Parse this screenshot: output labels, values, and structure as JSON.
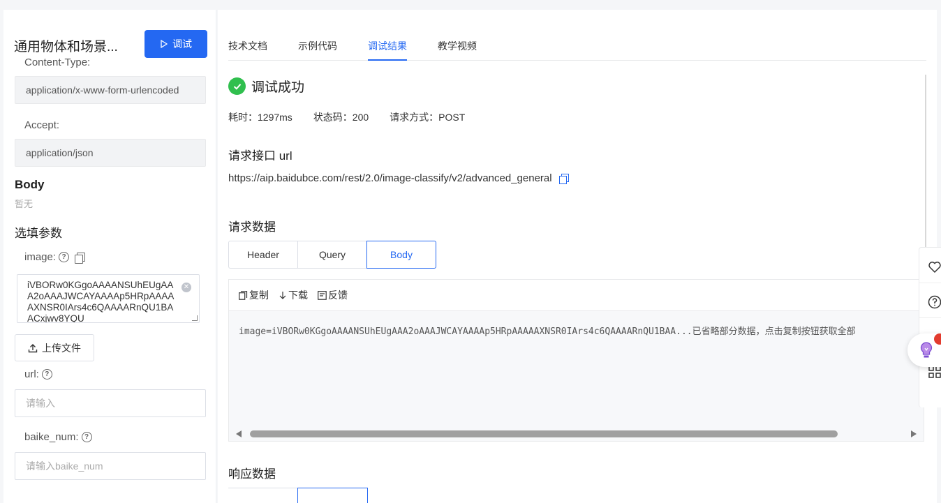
{
  "left": {
    "api_title": "通用物体和场景...",
    "debug_button": "调试",
    "content_type_label": "Content-Type:",
    "content_type_value": "application/x-www-form-urlencoded",
    "accept_label": "Accept:",
    "accept_value": "application/json",
    "body_heading": "Body",
    "body_empty": "暂无",
    "optional_heading": "选填参数",
    "image_label": "image:",
    "image_value": "iVBORw0KGgoAAAANSUhEUgAAA2oAAAJWCAYAAAAp5HRpAAAAAXNSR0IArs4c6QAAAARnQU1BAACxjwv8YQU",
    "upload_button": "上传文件",
    "url_label": "url:",
    "url_placeholder": "请输入",
    "baike_label": "baike_num:",
    "baike_placeholder": "请输入baike_num"
  },
  "tabs": [
    {
      "label": "技术文档"
    },
    {
      "label": "示例代码"
    },
    {
      "label": "调试结果",
      "active": true
    },
    {
      "label": "教学视频"
    }
  ],
  "result": {
    "status": "调试成功",
    "time": "耗时：1297ms",
    "status_code": "状态码：200",
    "method": "请求方式：POST",
    "url_heading": "请求接口 url",
    "url": "https://aip.baidubce.com/rest/2.0/image-classify/v2/advanced_general",
    "request_heading": "请求数据",
    "segments": [
      "Header",
      "Query",
      "Body"
    ],
    "active_segment": "Body",
    "tools": {
      "copy": "复制",
      "download": "下载",
      "feedback": "反馈"
    },
    "code": "image=iVBORw0KGgoAAAANSUhEUgAAA2oAAAJWCAYAAAAp5HRpAAAAAXNSR0IArs4c6QAAAARnQU1BAA...已省略部分数据，点击复制按钮获取全部",
    "response_heading": "响应数据"
  },
  "colors": {
    "accent": "#2468f2",
    "success": "#30bf4e",
    "notification": "#e23b2e"
  },
  "icons": {
    "favorite": "heart-icon",
    "help": "question-icon",
    "assistant": "lightbulb-icon",
    "grid": "grid-icon"
  }
}
